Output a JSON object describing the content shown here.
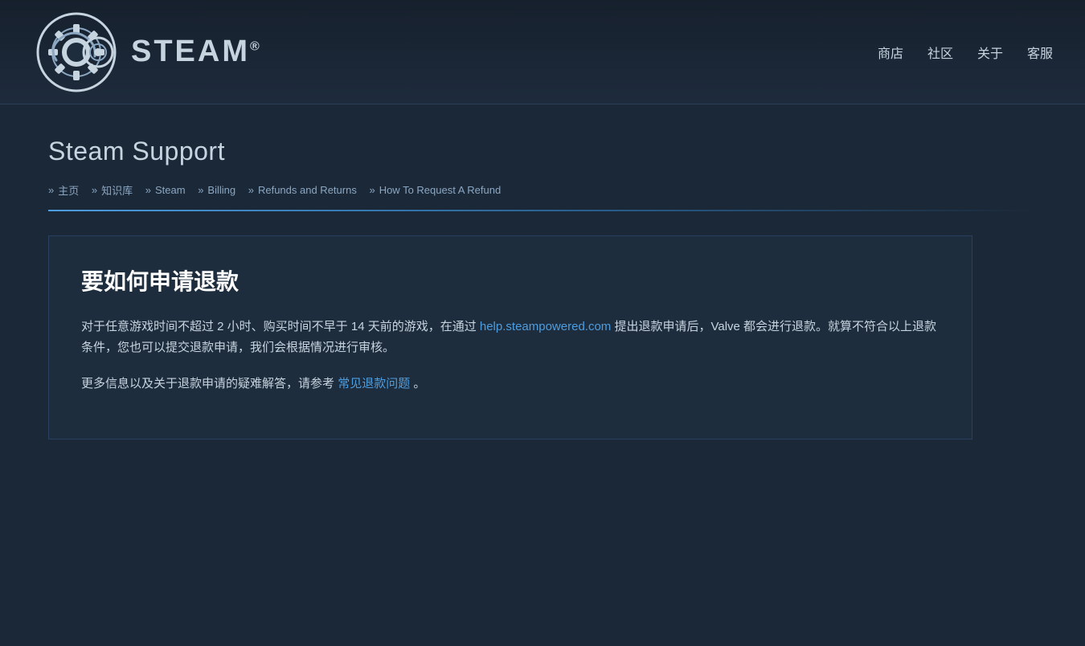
{
  "header": {
    "brand": "STEAM",
    "brand_trademark": "®",
    "nav": {
      "store": "商店",
      "community": "社区",
      "about": "关于",
      "support": "客服"
    }
  },
  "page": {
    "title": "Steam Support",
    "breadcrumb": [
      {
        "label": "主页",
        "href": "#"
      },
      {
        "label": "知识库",
        "href": "#"
      },
      {
        "label": "Steam",
        "href": "#"
      },
      {
        "label": "Billing",
        "href": "#"
      },
      {
        "label": "Refunds and Returns",
        "href": "#"
      },
      {
        "label": "How To Request A Refund",
        "href": "#"
      }
    ]
  },
  "article": {
    "title": "要如何申请退款",
    "paragraph1_part1": "对于任意游戏时间不超过 2 小时、购买时间不早于 14 天前的游戏，在通过",
    "paragraph1_link_text": "help.steampowered.com",
    "paragraph1_link_href": "#",
    "paragraph1_part2": " 提出退款申请后，Valve 都会进行退款。就算不符合以上退款条件，您也可以提交退款申请，我们会根据情况进行审核。",
    "paragraph2_part1": "更多信息以及关于退款申请的疑难解答，请参考",
    "paragraph2_link_text": "常见退款问题",
    "paragraph2_link_href": "#",
    "paragraph2_part2": "。"
  }
}
